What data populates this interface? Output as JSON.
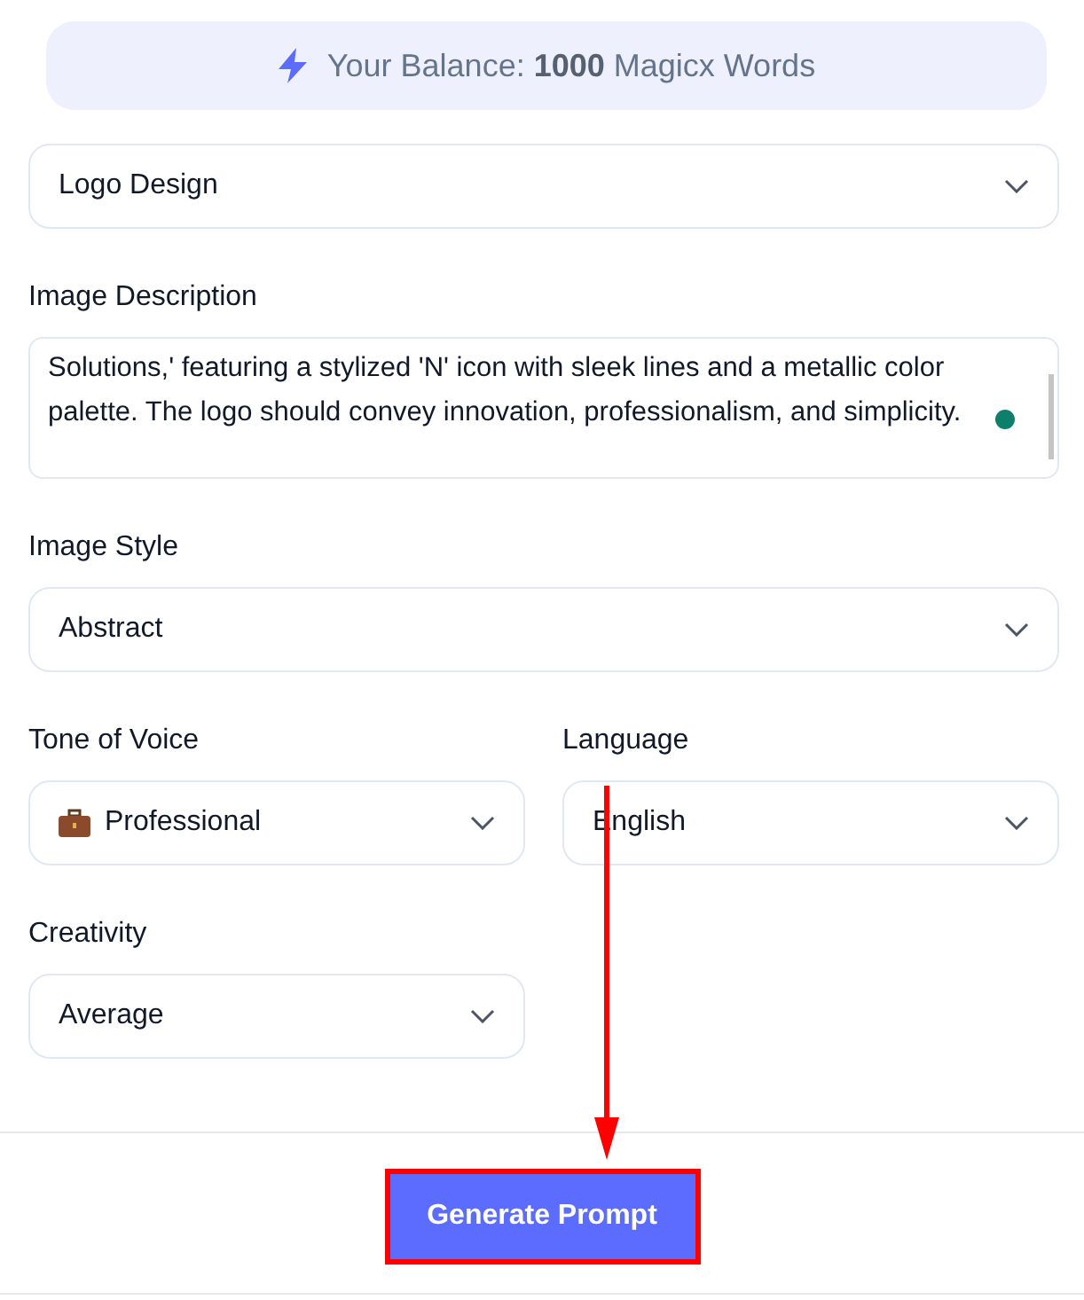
{
  "balance": "Your Balance: **1000** Magicx Words",
  "full_fields": [
    {
      "kind": "select",
      "value": "Logo Design"
    },
    {
      "kind": "textarea",
      "label": "Image Description",
      "value": "Solutions,' featuring a stylized 'N' icon with sleek lines and a metallic color palette. The logo should convey innovation, professionalism, and simplicity."
    },
    {
      "kind": "select",
      "label": "Image Style",
      "value": "Abstract"
    }
  ],
  "grid_fields": [
    {
      "kind": "iconselect",
      "label": "Tone of Voice",
      "value": "Professional"
    },
    {
      "kind": "select",
      "label": "Language",
      "value": "English"
    },
    {
      "kind": "select",
      "label": "Creativity",
      "value": "Average"
    }
  ],
  "button": "Generate Prompt"
}
